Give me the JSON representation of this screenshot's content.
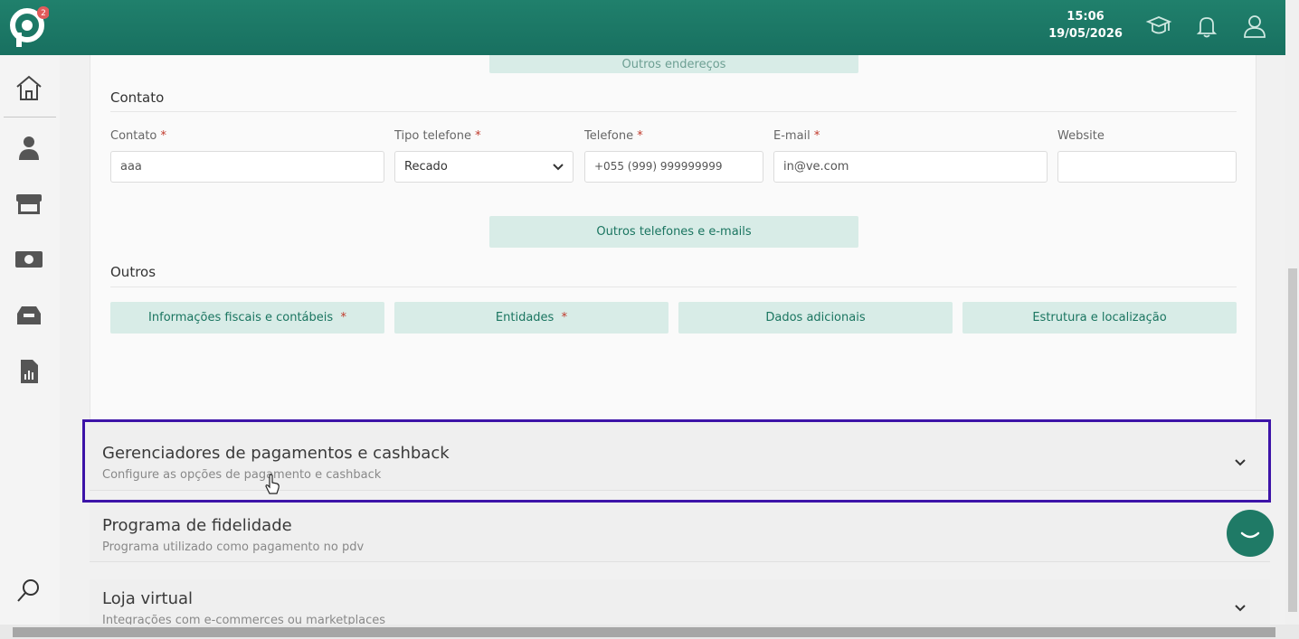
{
  "header": {
    "time": "15:06",
    "date": "19/05/2026",
    "logo_badge": "2"
  },
  "contato": {
    "partial_button": "Outros endereços",
    "section_title": "Contato",
    "fields": {
      "contato_label": "Contato",
      "contato_value": "aaa",
      "tipo_label": "Tipo telefone",
      "tipo_value": "Recado",
      "telefone_label": "Telefone",
      "telefone_value": "+055 (999) 999999999",
      "email_label": "E-mail",
      "email_value": "in@ve.com",
      "website_label": "Website",
      "website_value": ""
    },
    "required_mark": "*",
    "outros_button": "Outros telefones e e-mails"
  },
  "outros": {
    "section_title": "Outros",
    "buttons": [
      "Informações fiscais e contábeis",
      "Entidades",
      "Dados adicionais",
      "Estrutura e localização"
    ]
  },
  "accordions": [
    {
      "title": "Gerenciadores de pagamentos e cashback",
      "subtitle": "Configure as opções de pagamento e cashback"
    },
    {
      "title": "Programa de fidelidade",
      "subtitle": "Programa utilizado como pagamento no pdv"
    },
    {
      "title": "Loja virtual",
      "subtitle": "Integrações com e-commerces ou marketplaces"
    }
  ],
  "colors": {
    "brand": "#1a7a66",
    "highlight": "#3d14a8"
  }
}
